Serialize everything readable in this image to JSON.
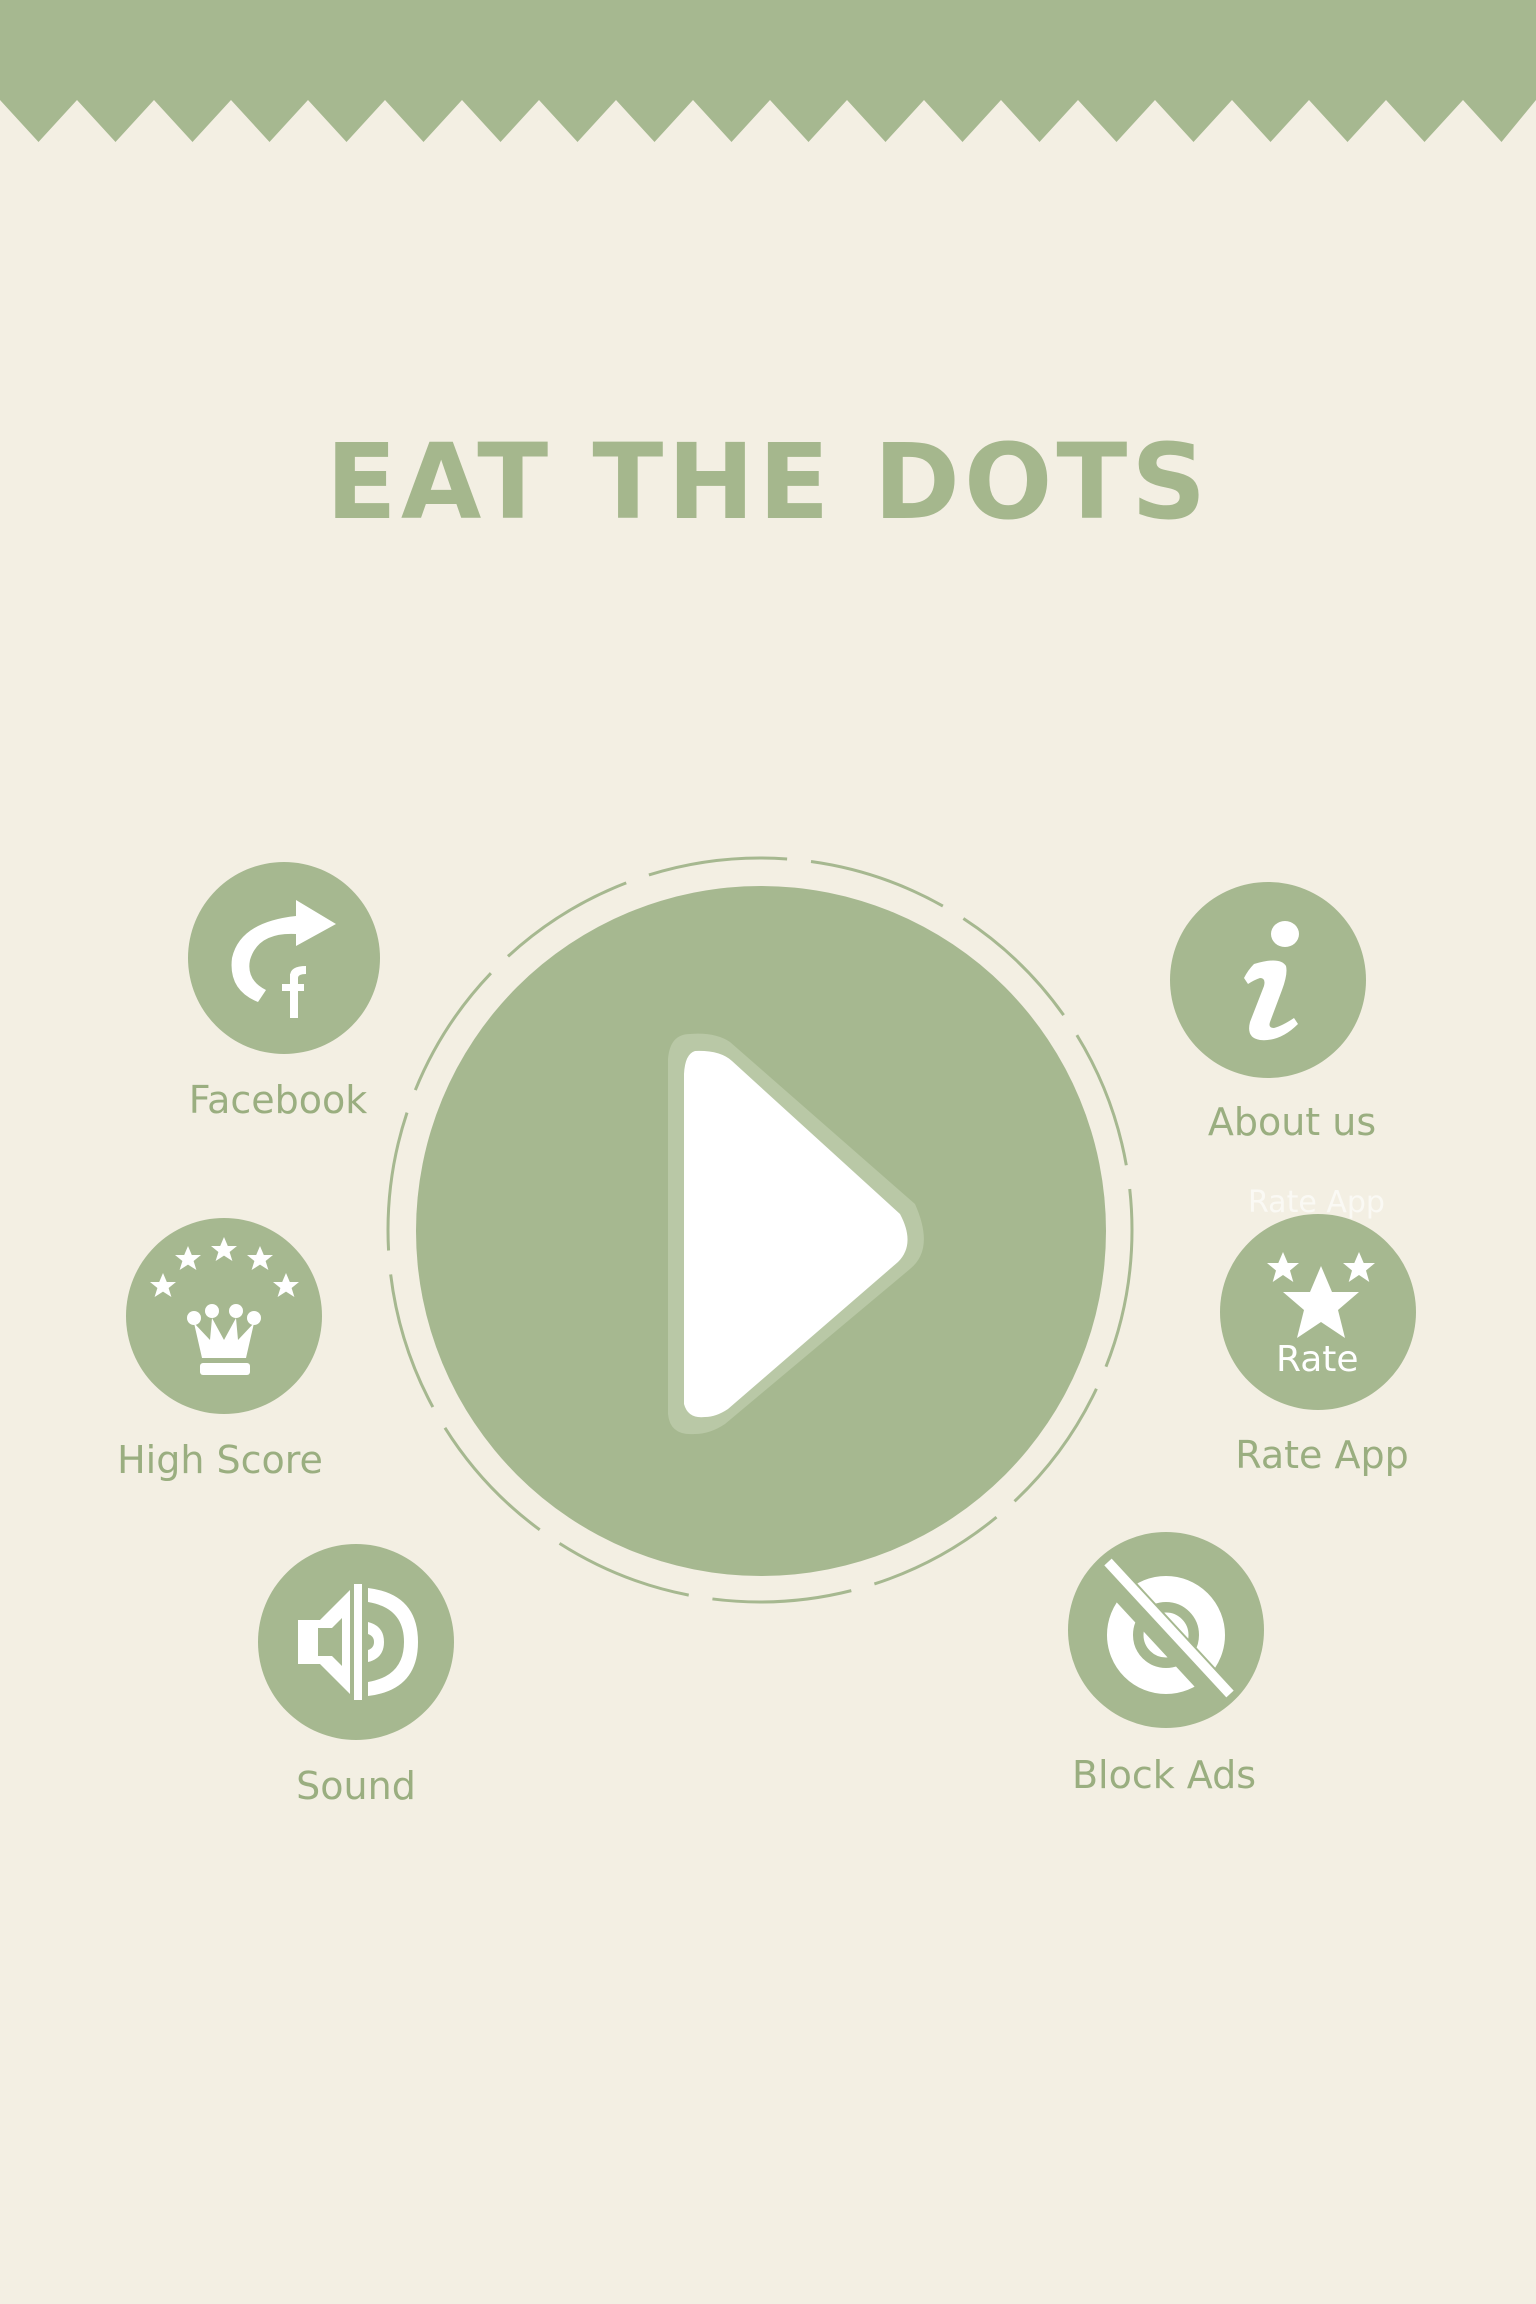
{
  "app": {
    "title": "EAT THE DOTS"
  },
  "colors": {
    "accent": "#a6b890",
    "background": "#f3efe3",
    "label": "#9aae80",
    "icon": "#ffffff"
  },
  "play": {
    "icon": "play-icon"
  },
  "menu": {
    "facebook": {
      "label": "Facebook",
      "icon": "share-facebook-icon"
    },
    "high_score": {
      "label": "High Score",
      "icon": "crown-stars-icon"
    },
    "sound": {
      "label": "Sound",
      "icon": "speaker-icon"
    },
    "about": {
      "label": "About us",
      "icon": "info-icon"
    },
    "rate": {
      "label": "Rate App",
      "icon": "star-rate-icon",
      "icon_text": "Rate",
      "ghost_label": "Rate App"
    },
    "block_ads": {
      "label": "Block Ads",
      "icon": "no-ads-icon"
    }
  }
}
